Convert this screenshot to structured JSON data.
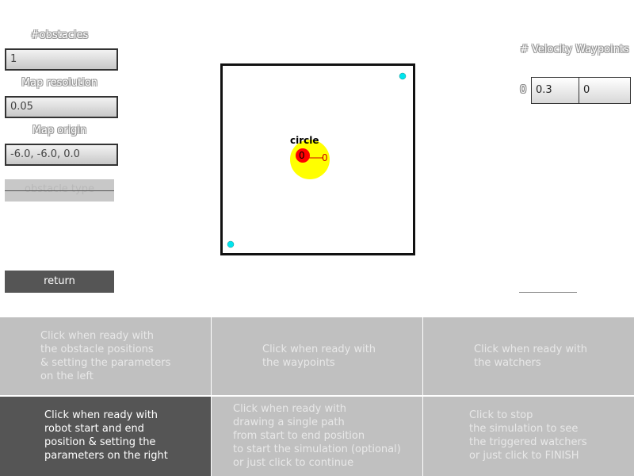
{
  "left_panel": {
    "obstacles_label": "#obstacles",
    "obstacles_value": "1",
    "map_resolution_label": "Map resolution",
    "map_resolution_value": "0.05",
    "map_origin_label": "Map origin",
    "map_origin_value": "-6.0, -6.0, 0.0",
    "obstacle_type_label": "obstacle type",
    "return_label": "return"
  },
  "map": {
    "obstacle_label": "circle",
    "obstacle_id": "0",
    "robot_label": "0",
    "colors": {
      "obstacle_fill": "#ffff00",
      "robot_fill": "#ff0000",
      "waypoint_fill": "#00e5ee",
      "border": "#111111"
    }
  },
  "right_panel": {
    "header": "# Velocity Waypoints",
    "waypoints": [
      {
        "index": "0",
        "x": "0.3",
        "y": "0"
      }
    ]
  },
  "steps": [
    {
      "text": "Click when ready with\nthe obstacle positions\n& setting the parameters\non the left"
    },
    {
      "text": "Click when ready with\nthe waypoints"
    },
    {
      "text": "Click when ready with\nthe watchers"
    },
    {
      "text": "Click when ready with\nrobot start and end\nposition & setting the\nparameters on the right"
    },
    {
      "text": "Click when ready with\ndrawing a single path\nfrom start to end position\nto start the simulation (optional)\nor just click to continue"
    },
    {
      "text": "Click to stop\nthe simulation to see\nthe triggered watchers\nor just click to FINISH"
    }
  ]
}
